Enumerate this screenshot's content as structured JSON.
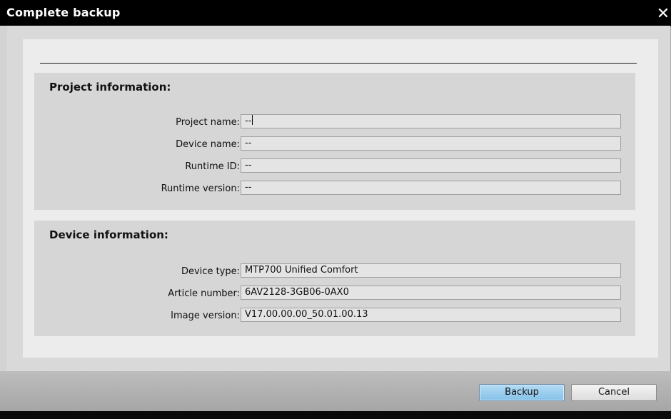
{
  "dialog": {
    "title": "Complete backup",
    "close_icon": "close-icon"
  },
  "project_info": {
    "title": "Project information:",
    "fields": [
      {
        "label": "Project name:",
        "value": "--"
      },
      {
        "label": "Device name:",
        "value": "--"
      },
      {
        "label": "Runtime ID:",
        "value": "--"
      },
      {
        "label": "Runtime version:",
        "value": "--"
      }
    ]
  },
  "device_info": {
    "title": "Device information:",
    "fields": [
      {
        "label": "Device type:",
        "value": "MTP700 Unified Comfort"
      },
      {
        "label": "Article number:",
        "value": "6AV2128-3GB06-0AX0"
      },
      {
        "label": "Image version:",
        "value": "V17.00.00.00_50.01.00.13"
      }
    ]
  },
  "buttons": {
    "backup_label": "Backup",
    "cancel_label": "Cancel"
  },
  "colors": {
    "titlebar": "#000000",
    "primary_button": "#9fcdee"
  }
}
